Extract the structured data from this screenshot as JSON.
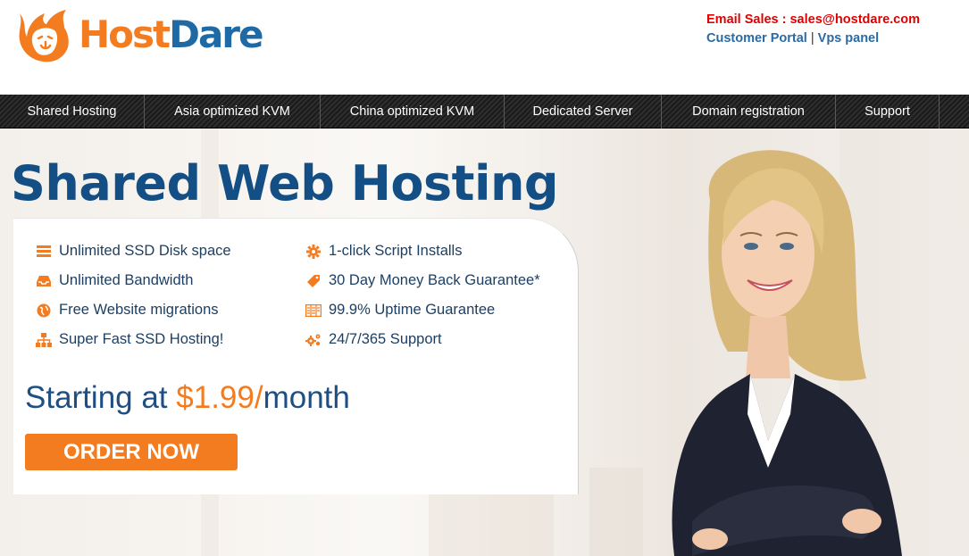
{
  "brand": {
    "host": "Host",
    "dare": "Dare",
    "colors": {
      "orange": "#f47c20",
      "blue": "#1f6aa5",
      "navy": "#134e85",
      "red": "#e00000"
    }
  },
  "contact": {
    "email_label": "Email Sales : sales@hostdare.com",
    "customer_portal": "Customer Portal",
    "separator": "|",
    "vps_panel": "Vps panel"
  },
  "nav": {
    "items": [
      {
        "label": "Shared Hosting"
      },
      {
        "label": "Asia optimized KVM"
      },
      {
        "label": "China optimized KVM"
      },
      {
        "label": "Dedicated Server"
      },
      {
        "label": "Domain registration"
      },
      {
        "label": "Support"
      }
    ]
  },
  "hero": {
    "title": "Shared Web Hosting",
    "features": [
      {
        "label": "Unlimited SSD Disk space",
        "icon": "server-icon"
      },
      {
        "label": "Unlimited Bandwidth",
        "icon": "inbox-icon"
      },
      {
        "label": "Free Website migrations",
        "icon": "globe-icon"
      },
      {
        "label": "Super Fast SSD Hosting!",
        "icon": "sitemap-icon"
      },
      {
        "label": "1-click Script Installs",
        "icon": "gear-icon"
      },
      {
        "label": "30 Day Money Back Guarantee*",
        "icon": "tag-icon"
      },
      {
        "label": "99.9% Uptime Guarantee",
        "icon": "columns-icon"
      },
      {
        "label": "24/7/365 Support",
        "icon": "cogs-icon"
      }
    ],
    "starting_prefix": "Starting at ",
    "price": "$1.99/",
    "starting_suffix": "month",
    "order_button": "ORDER NOW"
  }
}
